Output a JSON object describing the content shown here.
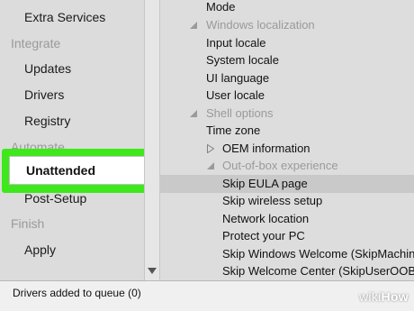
{
  "sidebar": {
    "extra_services": "Extra Services",
    "section_integrate": "Integrate",
    "updates": "Updates",
    "drivers": "Drivers",
    "registry": "Registry",
    "section_automate": "Automate",
    "unattended": "Unattended",
    "post_setup": "Post-Setup",
    "section_finish": "Finish",
    "apply": "Apply"
  },
  "tree": {
    "mode": "Mode",
    "windows_localization": "Windows localization",
    "input_locale": "Input locale",
    "system_locale": "System locale",
    "ui_language": "UI language",
    "user_locale": "User locale",
    "shell_options": "Shell options",
    "time_zone": "Time zone",
    "oem_information": "OEM information",
    "out_of_box_experience": "Out-of-box experience",
    "skip_eula_page": "Skip EULA page",
    "skip_wireless_setup": "Skip wireless setup",
    "network_location": "Network location",
    "protect_your_pc": "Protect your PC",
    "skip_windows_welcome": "Skip Windows Welcome (SkipMachineOOBE)",
    "skip_welcome_center": "Skip Welcome Center (SkipUserOOBE)"
  },
  "status": {
    "text": "Drivers added to queue (0)"
  },
  "watermark": {
    "wiki": "wiki",
    "how": "How"
  },
  "colors": {
    "highlight": "#3fe81c",
    "selected_row": "#c9c9c9"
  },
  "icons": {
    "expanded": "expanded-triangle-icon",
    "collapsed": "collapsed-triangle-icon",
    "scroll_down": "scroll-down-arrow-icon"
  }
}
